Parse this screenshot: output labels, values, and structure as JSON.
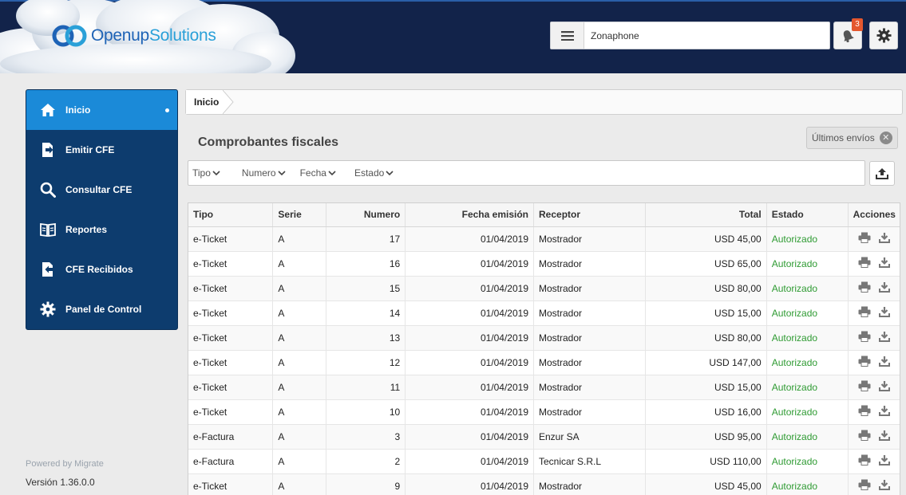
{
  "brand": {
    "name_part1": "Openup",
    "name_part2": "Solutions"
  },
  "header": {
    "company_name": "Zonaphone",
    "notifications_count": "3"
  },
  "sidebar": {
    "items": [
      {
        "label": "Inicio",
        "icon": "home-icon",
        "active": true
      },
      {
        "label": "Emitir CFE",
        "icon": "emit-document-icon"
      },
      {
        "label": "Consultar CFE",
        "icon": "search-icon"
      },
      {
        "label": "Reportes",
        "icon": "book-icon"
      },
      {
        "label": "CFE Recibidos",
        "icon": "received-document-icon"
      },
      {
        "label": "Panel de Control",
        "icon": "gear-icon"
      }
    ],
    "powered_by": "Powered by Migrate",
    "version": "Versión 1.36.0.0"
  },
  "breadcrumb": {
    "current": "Inicio"
  },
  "main": {
    "title": "Comprobantes fiscales",
    "last_sends_label": "Últimos envíos",
    "filters": [
      "Tipo",
      "Numero",
      "Fecha",
      "Estado"
    ]
  },
  "table": {
    "columns": [
      "Tipo",
      "Serie",
      "Numero",
      "Fecha emisión",
      "Receptor",
      "Total",
      "Estado",
      "Acciones"
    ],
    "rows": [
      [
        "e-Ticket",
        "A",
        "17",
        "01/04/2019",
        "Mostrador",
        "USD 45,00",
        "Autorizado"
      ],
      [
        "e-Ticket",
        "A",
        "16",
        "01/04/2019",
        "Mostrador",
        "USD 65,00",
        "Autorizado"
      ],
      [
        "e-Ticket",
        "A",
        "15",
        "01/04/2019",
        "Mostrador",
        "USD 80,00",
        "Autorizado"
      ],
      [
        "e-Ticket",
        "A",
        "14",
        "01/04/2019",
        "Mostrador",
        "USD 15,00",
        "Autorizado"
      ],
      [
        "e-Ticket",
        "A",
        "13",
        "01/04/2019",
        "Mostrador",
        "USD 80,00",
        "Autorizado"
      ],
      [
        "e-Ticket",
        "A",
        "12",
        "01/04/2019",
        "Mostrador",
        "USD 147,00",
        "Autorizado"
      ],
      [
        "e-Ticket",
        "A",
        "11",
        "01/04/2019",
        "Mostrador",
        "USD 15,00",
        "Autorizado"
      ],
      [
        "e-Ticket",
        "A",
        "10",
        "01/04/2019",
        "Mostrador",
        "USD 16,00",
        "Autorizado"
      ],
      [
        "e-Factura",
        "A",
        "3",
        "01/04/2019",
        "Enzur SA",
        "USD 95,00",
        "Autorizado"
      ],
      [
        "e-Factura",
        "A",
        "2",
        "01/04/2019",
        "Tecnicar S.R.L",
        "USD 110,00",
        "Autorizado"
      ],
      [
        "e-Ticket",
        "A",
        "9",
        "01/04/2019",
        "Mostrador",
        "USD 45,00",
        "Autorizado"
      ]
    ]
  },
  "colors": {
    "header_bg": "#12234a",
    "sidebar_bg": "#0d3c6e",
    "sidebar_active": "#1b8ad8",
    "status_ok": "#2f9b33",
    "badge": "#e4572e"
  }
}
